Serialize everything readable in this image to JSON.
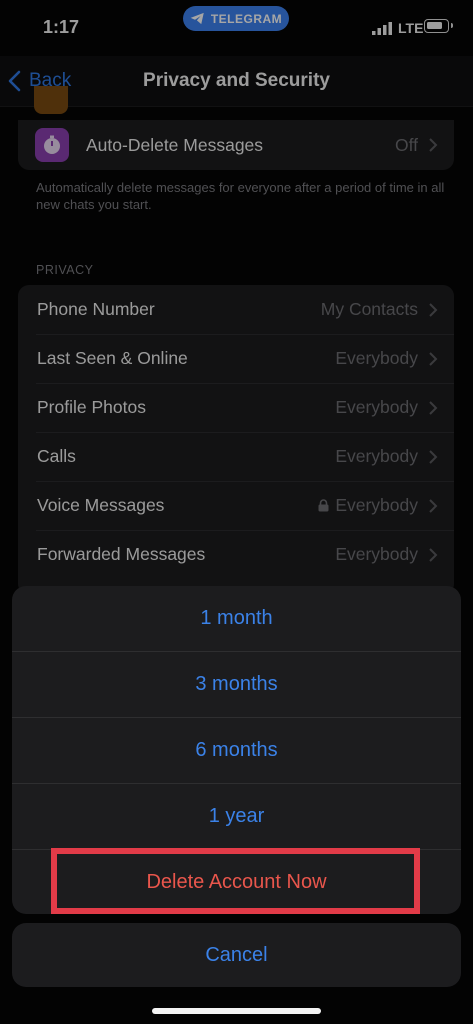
{
  "status": {
    "time": "1:17",
    "app_pill": "TELEGRAM",
    "network": "LTE"
  },
  "nav": {
    "back_label": "Back",
    "title": "Privacy and Security"
  },
  "auto_delete": {
    "label": "Auto-Delete Messages",
    "value": "Off",
    "note": "Automatically delete messages for everyone after a period of time in all new chats you start."
  },
  "privacy": {
    "header": "PRIVACY",
    "rows": [
      {
        "label": "Phone Number",
        "value": "My Contacts"
      },
      {
        "label": "Last Seen & Online",
        "value": "Everybody"
      },
      {
        "label": "Profile Photos",
        "value": "Everybody"
      },
      {
        "label": "Calls",
        "value": "Everybody"
      },
      {
        "label": "Voice Messages",
        "value": "Everybody",
        "locked": true
      },
      {
        "label": "Forwarded Messages",
        "value": "Everybody"
      }
    ]
  },
  "action_sheet": {
    "options": [
      "1 month",
      "3 months",
      "6 months",
      "1 year"
    ],
    "delete_label": "Delete Account Now",
    "cancel_label": "Cancel"
  },
  "colors": {
    "accent": "#3b82e8",
    "destructive": "#e9564c",
    "highlight": "#e23b48"
  }
}
